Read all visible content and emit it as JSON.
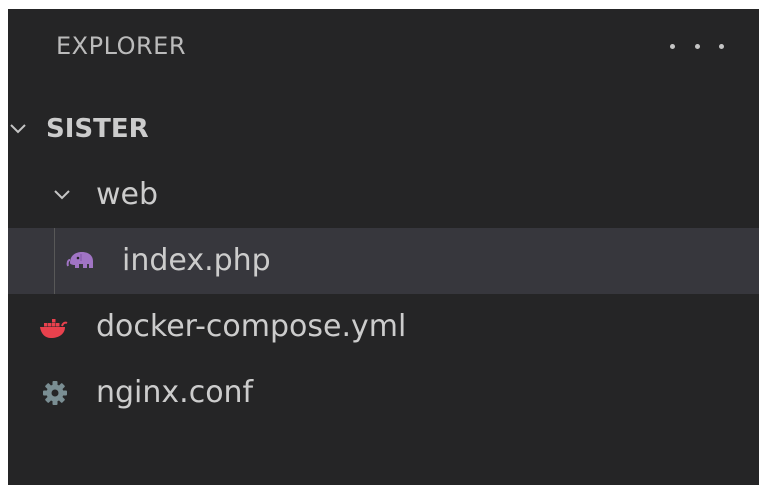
{
  "explorer": {
    "title": "EXPLORER",
    "more_actions_icon": "ellipsis-icon"
  },
  "tree": {
    "root": {
      "label": "SISTER",
      "expanded": true
    },
    "folder_web": {
      "label": "web",
      "expanded": true
    },
    "file_index": {
      "label": "index.php",
      "icon": "php-elephant-icon",
      "icon_color": "#a074c4",
      "selected": true
    },
    "file_docker": {
      "label": "docker-compose.yml",
      "icon": "docker-whale-icon",
      "icon_color": "#e8414d"
    },
    "file_nginx": {
      "label": "nginx.conf",
      "icon": "gear-icon",
      "icon_color": "#7a8e93"
    }
  },
  "colors": {
    "panel_bg": "#252526",
    "selected_row_bg": "#37373d",
    "text": "#cccccc"
  }
}
